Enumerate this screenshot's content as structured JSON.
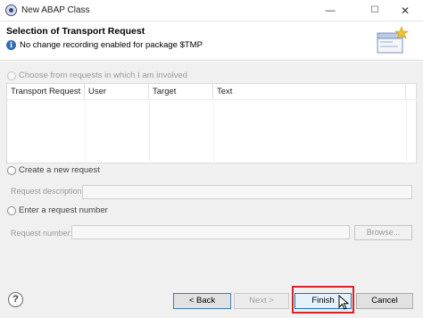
{
  "window": {
    "title": "New ABAP Class",
    "minimize_glyph": "—",
    "maximize_glyph": "☐",
    "close_glyph": "✕"
  },
  "header": {
    "title": "Selection of Transport Request",
    "message": "No change recording enabled for package $TMP",
    "info_icon_glyph": "i"
  },
  "options": {
    "choose_from_requests": "Choose from requests in which I am involved",
    "create_new_request": "Create a new request",
    "enter_request_number": "Enter a request number"
  },
  "table": {
    "columns": [
      "Transport Request",
      "User",
      "Target",
      "Text"
    ],
    "rows": []
  },
  "fields": {
    "request_description_label": "Request description:",
    "request_description_value": "",
    "request_number_label": "Request number:",
    "request_number_value": "",
    "browse_label": "Browse..."
  },
  "footer": {
    "help_glyph": "?",
    "back_label": "< Back",
    "next_label": "Next >",
    "finish_label": "Finish",
    "cancel_label": "Cancel"
  },
  "colors": {
    "highlight": "#d9232b",
    "info_blue": "#2f6db7",
    "focus_border": "#1f6fbf"
  }
}
